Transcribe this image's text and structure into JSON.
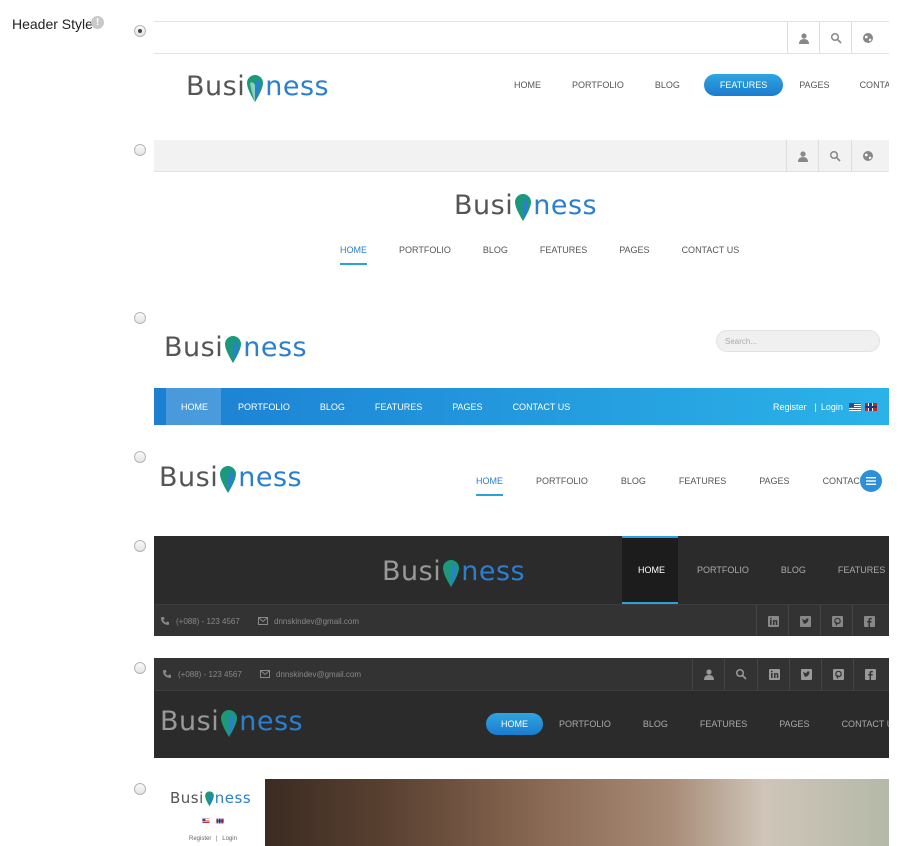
{
  "field": {
    "label": "Header Style",
    "info": "!"
  },
  "logo": {
    "part1": "Busi",
    "part2": "ness"
  },
  "nav": [
    "HOME",
    "PORTFOLIO",
    "BLOG",
    "FEATURES",
    "PAGES",
    "CONTACT US"
  ],
  "nav_short": [
    "HOME",
    "PORTFOLIO",
    "BLOG",
    "FEATURES"
  ],
  "search_placeholder": "Search...",
  "auth": {
    "register": "Register",
    "separator": "|",
    "login": "Login"
  },
  "contact": {
    "phone": "(+088) - 123 4567",
    "email": "dnnskindev@gmail.com"
  },
  "selected_style": 1,
  "colors": {
    "accent": "#2a7fcf",
    "pill": "#1e8ad5",
    "dark": "#2b2b2b",
    "teal": "#1a9a7a"
  },
  "icons": [
    "user-icon",
    "search-icon",
    "globe-icon",
    "linkedin-icon",
    "twitter-icon",
    "pinterest-icon",
    "facebook-icon",
    "phone-icon",
    "mail-icon",
    "menu-icon"
  ]
}
